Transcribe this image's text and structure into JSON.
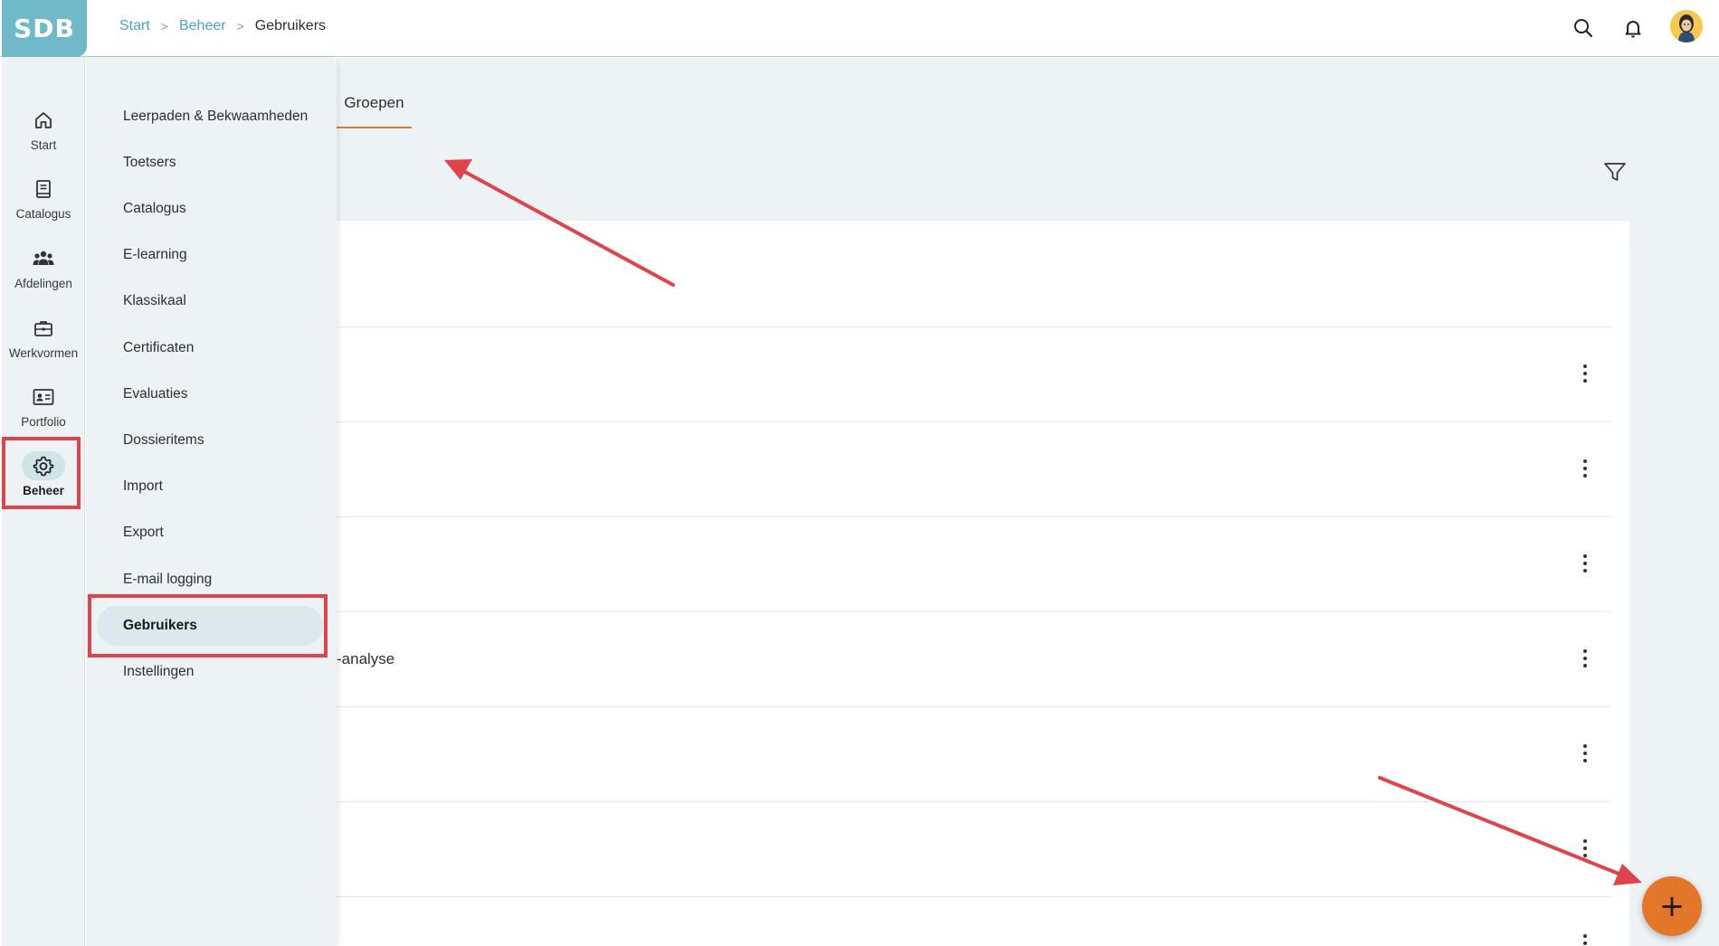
{
  "header": {
    "logo_text": "SDB",
    "breadcrumb": {
      "start": "Start",
      "beheer": "Beheer",
      "current": "Gebruikers",
      "separator": ">"
    }
  },
  "rail": {
    "items": [
      {
        "label": "Start",
        "icon": "home-icon"
      },
      {
        "label": "Catalogus",
        "icon": "book-icon"
      },
      {
        "label": "Afdelingen",
        "icon": "group-icon"
      },
      {
        "label": "Werkvormen",
        "icon": "briefcase-icon"
      },
      {
        "label": "Portfolio",
        "icon": "id-card-icon"
      },
      {
        "label": "Beheer",
        "icon": "gear-icon",
        "active": true
      }
    ]
  },
  "drawer": {
    "items": [
      {
        "label": "Leerpaden & Bekwaamheden"
      },
      {
        "label": "Toetsers"
      },
      {
        "label": "Catalogus"
      },
      {
        "label": "E-learning"
      },
      {
        "label": "Klassikaal"
      },
      {
        "label": "Certificaten"
      },
      {
        "label": "Evaluaties"
      },
      {
        "label": "Dossieritems"
      },
      {
        "label": "Import"
      },
      {
        "label": "Export"
      },
      {
        "label": "E-mail logging"
      },
      {
        "label": "Gebruikers",
        "active": true
      },
      {
        "label": "Instellingen"
      }
    ]
  },
  "main": {
    "tab_label": "Groepen",
    "rows": [
      {
        "text": ""
      },
      {
        "text": ""
      },
      {
        "text": ""
      },
      {
        "text": "-analyse"
      },
      {
        "text": ""
      },
      {
        "text": ""
      },
      {
        "text": ""
      }
    ],
    "fab_label": "+"
  },
  "colors": {
    "accent": "#e4762a",
    "brand": "#6fb9c9",
    "highlight": "#e0434b",
    "background": "#edf3f5"
  }
}
